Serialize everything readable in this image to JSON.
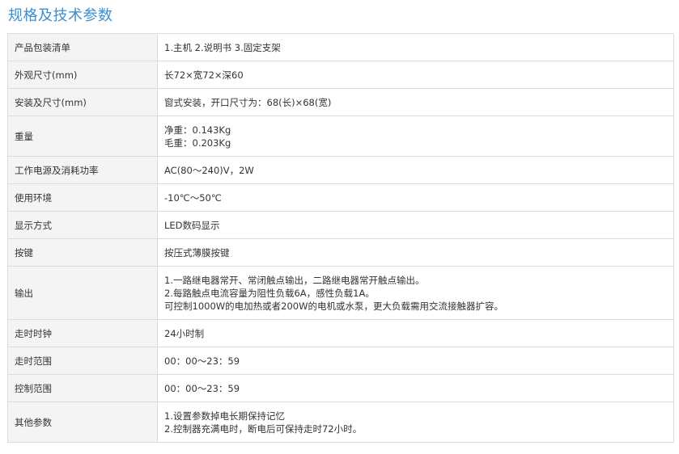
{
  "page_title": "规格及技术参数",
  "rows": [
    {
      "key": "产品包装清单",
      "lines": [
        "1.主机 2.说明书 3.固定支架"
      ]
    },
    {
      "key": "外观尺寸(mm)",
      "lines": [
        "长72×宽72×深60"
      ]
    },
    {
      "key": "安装及尺寸(mm)",
      "lines": [
        "窗式安装，开口尺寸为：68(长)×68(宽)"
      ]
    },
    {
      "key": "重量",
      "lines": [
        "净重：0.143Kg",
        "毛重：0.203Kg"
      ]
    },
    {
      "key": "工作电源及消耗功率",
      "lines": [
        "AC(80～240)V，2W"
      ]
    },
    {
      "key": "使用环境",
      "lines": [
        "-10℃～50℃"
      ]
    },
    {
      "key": "显示方式",
      "lines": [
        "LED数码显示"
      ]
    },
    {
      "key": "按键",
      "lines": [
        "按压式薄膜按键"
      ]
    },
    {
      "key": "输出",
      "lines": [
        "1.一路继电器常开、常闭触点输出，二路继电器常开触点输出。",
        "2.每路触点电流容量为阻性负载6A，感性负载1A。",
        "可控制1000W的电加热或者200W的电机或水泵，更大负载需用交流接触器扩容。"
      ]
    },
    {
      "key": "走时时钟",
      "lines": [
        "24小时制"
      ]
    },
    {
      "key": "走时范围",
      "lines": [
        "00：00～23：59"
      ]
    },
    {
      "key": "控制范围",
      "lines": [
        "00：00～23：59"
      ]
    },
    {
      "key": "其他参数",
      "lines": [
        "1.设置参数掉电长期保持记忆",
        "2.控制器充满电时，断电后可保持走时72小时。"
      ]
    }
  ]
}
